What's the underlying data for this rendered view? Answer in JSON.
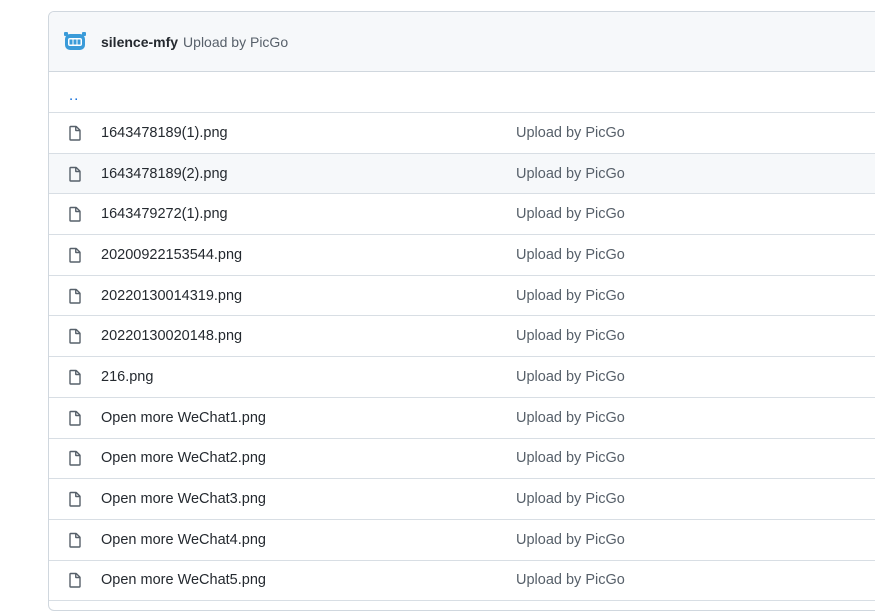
{
  "header": {
    "author": "silence-mfy",
    "commit_message": "Upload by PicGo"
  },
  "parent_link": "..",
  "files": [
    {
      "name": "1643478189(1).png",
      "commit": "Upload by PicGo"
    },
    {
      "name": "1643478189(2).png",
      "commit": "Upload by PicGo"
    },
    {
      "name": "1643479272(1).png",
      "commit": "Upload by PicGo"
    },
    {
      "name": "20200922153544.png",
      "commit": "Upload by PicGo"
    },
    {
      "name": "20220130014319.png",
      "commit": "Upload by PicGo"
    },
    {
      "name": "20220130020148.png",
      "commit": "Upload by PicGo"
    },
    {
      "name": "216.png",
      "commit": "Upload by PicGo"
    },
    {
      "name": "Open more WeChat1.png",
      "commit": "Upload by PicGo"
    },
    {
      "name": "Open more WeChat2.png",
      "commit": "Upload by PicGo"
    },
    {
      "name": "Open more WeChat3.png",
      "commit": "Upload by PicGo"
    },
    {
      "name": "Open more WeChat4.png",
      "commit": "Upload by PicGo"
    },
    {
      "name": "Open more WeChat5.png",
      "commit": "Upload by PicGo"
    }
  ],
  "icons": {
    "avatar": "picgo-avatar-icon",
    "file": "file-icon"
  },
  "colors": {
    "header_bg": "#f6f8fa",
    "border": "#d0d7de",
    "link": "#0969da",
    "muted_text": "#57606a",
    "avatar_blue": "#3a9bd9"
  }
}
